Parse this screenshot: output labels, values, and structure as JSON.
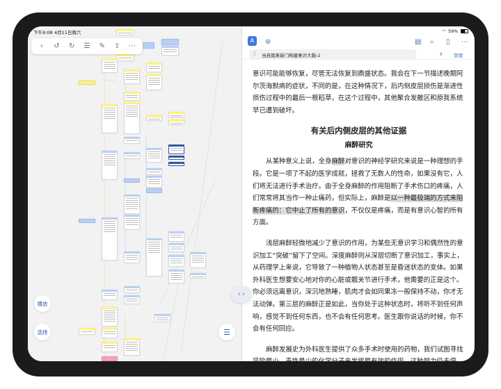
{
  "status_bar": {
    "time": "下午9:08",
    "date": "4月11日周六",
    "battery": "59%"
  },
  "left_panel": {
    "play_label": "播放",
    "select_label": "选择"
  },
  "toolbar": {
    "items": [
      "back-icon",
      "undo-icon",
      "redo-icon",
      "list-icon",
      "edit-icon",
      "share-icon",
      "more-icon"
    ]
  },
  "reader": {
    "tab_title": "当自我来敲门构建意识大脑-2",
    "manage_label": "管理",
    "para1": "意识可能能够恢复，尽管无法恢复到鼎盛状态。我会在下一节描述晚期阿尔茨海默病的症状，不同的是，在这种情况下，后内侧皮层损伤是渐进性损伤过程中的最后一根稻草，在这个过程中，其他聚合发散区和原我系统早已遭到破坏。",
    "heading": "有关后内侧皮层的其他证据",
    "subheading": "麻醉研究",
    "para2_a": "从某种意义上说，全身",
    "para2_hl1": "麻醉",
    "para2_b": "对意识的神经学研究来说是一种理想的手段。它是一项了不起的医学成就，拯救了无数人的性命，如果没有它，人们将无法进行手术治疗。由于全身麻醉的作用阻断了手术伤口的疼痛，人们常常将其当作一种止痛药，但实际上，麻醉是",
    "para2_hl2": "以一种最极端的方式来阻断疼痛的：它中止了所有的意识",
    "para2_c": "，不仅仅是疼痛，而是有意识心智的所有方面。",
    "para3": "浅层麻醉轻微地减少了意识的作用，为某些无意识学习和偶然性的意识加工“突破”留下了空间。深度麻醉则从深层切断了意识加工，事实上，从药理学上来说，它导致了一种植物人状态甚至是昏迷状态的变体。如果外科医生想要安心地对你的心脏或髋关节进行手术，他需要的正是这个。你必须远离意识，深沉地熟睡，肌肉才会如同果冻一般保持不动，你才无法动弹。第三层的麻醉正是如此，当你处于这种状态时，将听不到任何声响，感觉不到任何东西，也不会有任何思考。医生跟你说话的时候，你不会有任何回应。",
    "para4": "麻醉发展史为外科医生提供了众多手术时使用的药物，我们试图寻找风险最小、毒性最少的化学分子来发挥最有效的作用，这种努力仍未停止。总体上看，麻醉剂是通过增加神经回路中的抑制剂来发挥作用的。要达到这一结果，"
  },
  "colors": {
    "accent": "#4a6fc0",
    "node_yellow": "#fff27a",
    "node_blue": "#b9cff5",
    "node_pink": "#f4a7b9"
  }
}
